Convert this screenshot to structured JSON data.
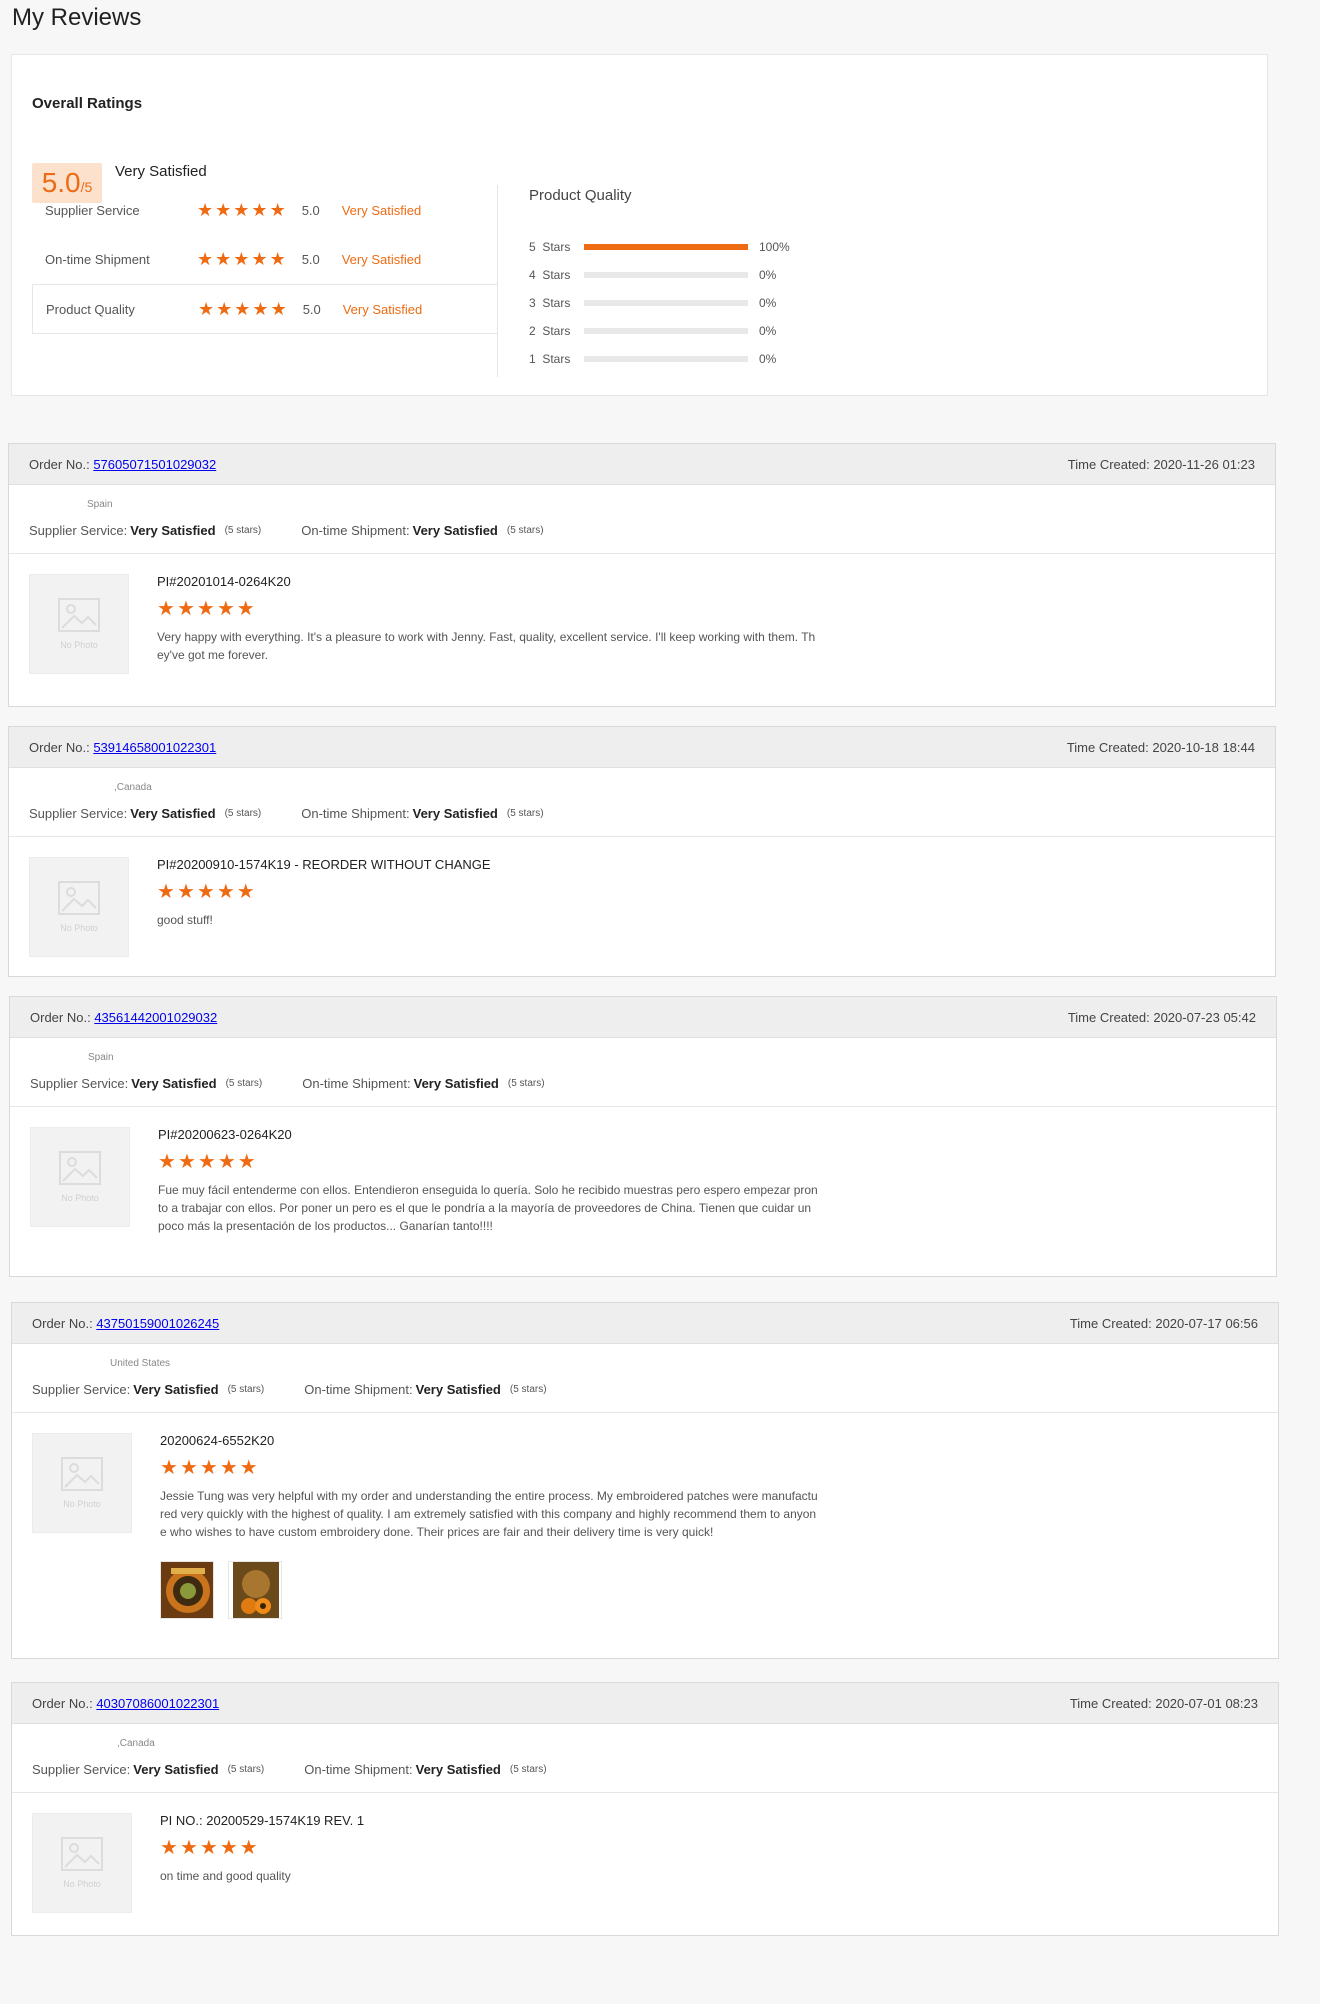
{
  "page_title": "My Reviews",
  "overall": {
    "title": "Overall Ratings",
    "score": "5.0",
    "score_out": "/5",
    "score_text": "Very Satisfied",
    "rows": [
      {
        "label": "Supplier Service",
        "value": "5.0",
        "desc": "Very Satisfied",
        "stars": 5
      },
      {
        "label": "On-time Shipment",
        "value": "5.0",
        "desc": "Very Satisfied",
        "stars": 5
      },
      {
        "label": "Product Quality",
        "value": "5.0",
        "desc": "Very Satisfied",
        "stars": 5
      }
    ],
    "pq_title": "Product Quality",
    "distribution": [
      {
        "label": "5  Stars",
        "pct": "100%",
        "fraction": 1.0
      },
      {
        "label": "4  Stars",
        "pct": "0%",
        "fraction": 0
      },
      {
        "label": "3  Stars",
        "pct": "0%",
        "fraction": 0
      },
      {
        "label": "2  Stars",
        "pct": "0%",
        "fraction": 0
      },
      {
        "label": "1  Stars",
        "pct": "0%",
        "fraction": 0
      }
    ]
  },
  "labels": {
    "order_no": "Order No.:",
    "time_created": "Time Created:",
    "supplier_service": "Supplier Service:",
    "on_time_shipment": "On-time Shipment:",
    "very_satisfied": "Very Satisfied",
    "five_stars": "(5 stars)",
    "no_photo": "No Photo"
  },
  "orders": [
    {
      "order_no": "57605071501029032",
      "time": "2020-11-26 01:23",
      "country": "Spain",
      "title": "PI#20201014-0264K20",
      "stars": 5,
      "text": "Very happy with everything. It's a pleasure to work with Jenny. Fast, quality, excellent service. I'll keep working with them. They've got me forever."
    },
    {
      "order_no": "53914658001022301",
      "time": "2020-10-18 18:44",
      "country": ",Canada",
      "title": "PI#20200910-1574K19 - REORDER WITHOUT CHANGE",
      "stars": 5,
      "text": "good stuff!"
    },
    {
      "order_no": "43561442001029032",
      "time": "2020-07-23 05:42",
      "country": "Spain",
      "title": "PI#20200623-0264K20",
      "stars": 5,
      "text": "Fue muy fácil entenderme con ellos. Entendieron enseguida lo quería. Solo he recibido muestras pero espero empezar pronto a trabajar con ellos. Por poner un pero es el que le pondría a la mayoría de proveedores de China. Tienen que cuidar un poco más la presentación de los productos... Ganarían tanto!!!!"
    },
    {
      "order_no": "43750159001026245",
      "time": "2020-07-17 06:56",
      "country": "United States",
      "title": "20200624-6552K20",
      "stars": 5,
      "text": "Jessie Tung was very helpful with my order and understanding the entire process.  My embroidered patches were manufactured very quickly with the highest of quality.  I am extremely satisfied with this company and highly recommend them to anyone who wishes to have custom embroidery done.  Their prices are fair and their delivery time is very quick!"
    },
    {
      "order_no": "40307086001022301",
      "time": "2020-07-01 08:23",
      "country": ",Canada",
      "title": "PI NO.: 20200529-1574K19 REV. 1",
      "stars": 5,
      "text": "on time and good quality"
    }
  ],
  "colors": {
    "accent": "#ee6b13",
    "link": "#2d79c7"
  }
}
